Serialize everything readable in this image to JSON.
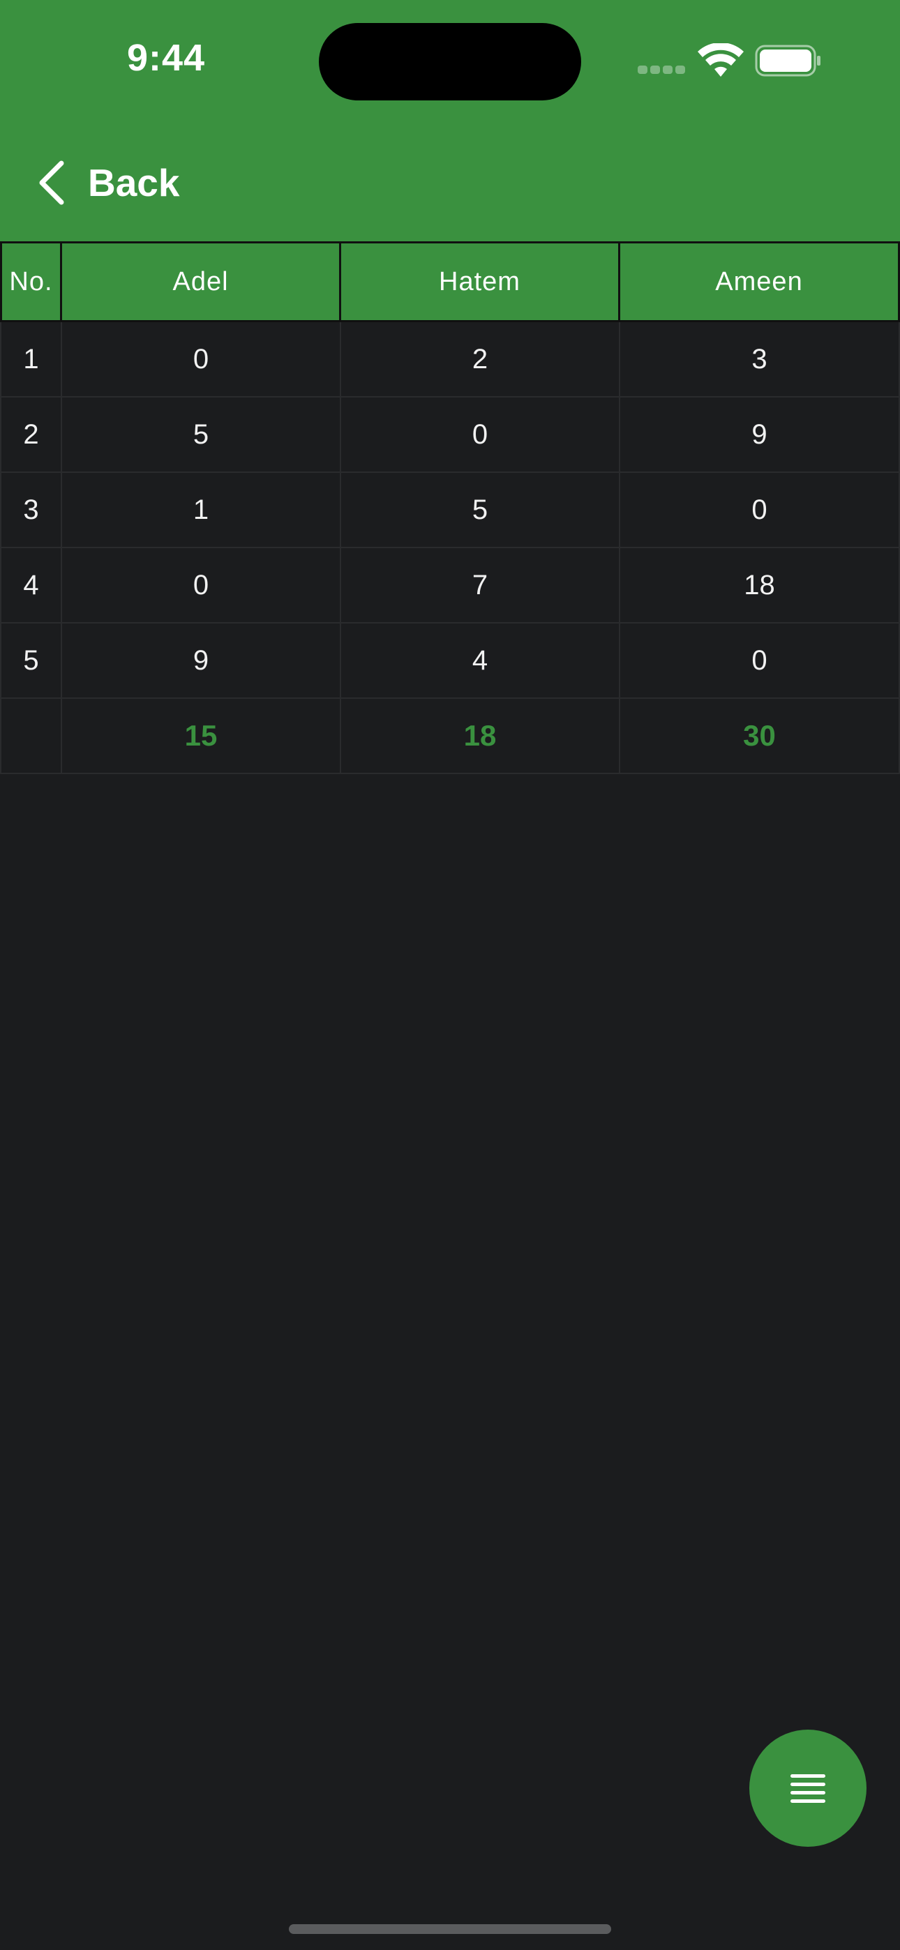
{
  "status_bar": {
    "time": "9:44"
  },
  "nav": {
    "back_label": "Back"
  },
  "table": {
    "columns": [
      "No.",
      "Adel",
      "Hatem",
      "Ameen"
    ],
    "rows": [
      [
        "1",
        "0",
        "2",
        "3"
      ],
      [
        "2",
        "5",
        "0",
        "9"
      ],
      [
        "3",
        "1",
        "5",
        "0"
      ],
      [
        "4",
        "0",
        "7",
        "18"
      ],
      [
        "5",
        "9",
        "4",
        "0"
      ]
    ],
    "totals": [
      "",
      "15",
      "18",
      "30"
    ]
  },
  "fab": {
    "icon": "menu-icon"
  },
  "colors": {
    "accent": "#3a913f",
    "background": "#1b1c1e"
  }
}
